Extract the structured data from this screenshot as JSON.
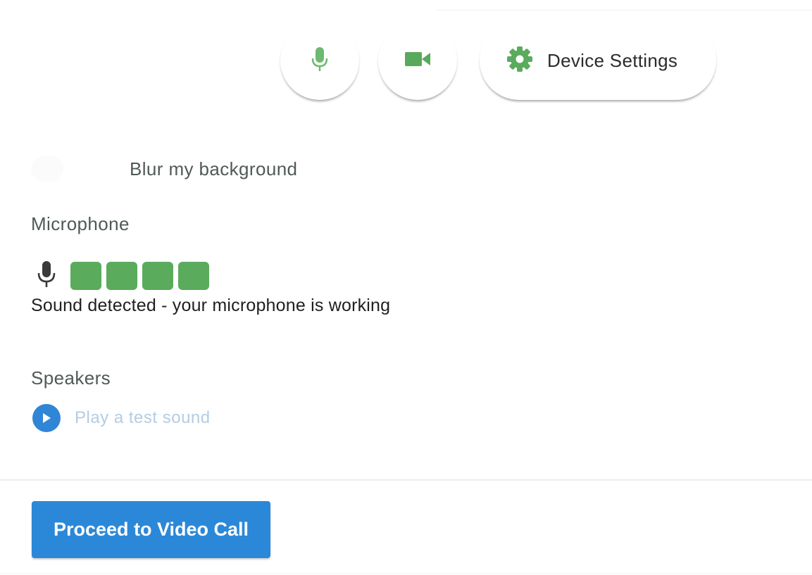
{
  "controls": {
    "device_settings_label": "Device Settings"
  },
  "blur": {
    "label": "Blur my background",
    "enabled": false
  },
  "microphone": {
    "title": "Microphone",
    "level_bars_active": 4,
    "status": "Sound detected - your microphone is working"
  },
  "speakers": {
    "title": "Speakers",
    "test_label": "Play a test sound"
  },
  "proceed_label": "Proceed to Video Call",
  "icons": {
    "mic_toggle": "microphone-icon",
    "camera_toggle": "videocam-icon",
    "settings": "gear-icon",
    "meter_mic": "microphone-icon",
    "play": "play-circle-icon"
  },
  "colors": {
    "green": "#5aab5c",
    "blue": "#2b88d8",
    "muted_text": "#4f5a56",
    "link_faint": "#b4cce3"
  }
}
